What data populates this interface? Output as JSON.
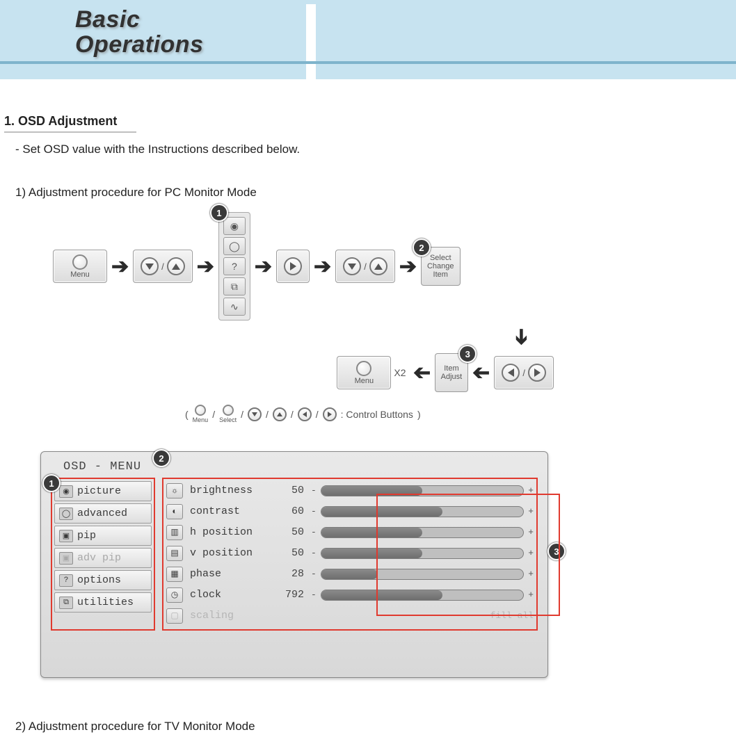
{
  "header": {
    "title_line1": "Basic",
    "title_line2": "Operations"
  },
  "section": {
    "heading": "1. OSD Adjustment",
    "intro": "- Set OSD value with the Instructions described below.",
    "sub1": "1) Adjustment procedure for PC Monitor Mode",
    "sub2": "2) Adjustment procedure for TV Monitor Mode"
  },
  "flow": {
    "menu_label": "Menu",
    "step2": {
      "l1": "Select",
      "l2": "Change",
      "l3": "Item"
    },
    "step3": {
      "l1": "Item",
      "l2": "Adjust"
    },
    "menu_x2_label": "Menu",
    "menu_x2_suffix": "X2",
    "badges": {
      "b1": "1",
      "b2": "2",
      "b3": "3"
    },
    "legend_suffix": ": Control Buttons",
    "legend_menu": "Menu",
    "legend_select": "Select",
    "category_icons": [
      "◉",
      "◯",
      "?",
      "⧉",
      "∿"
    ]
  },
  "osd": {
    "title": "OSD - MENU",
    "badges": {
      "b1": "1",
      "b2": "2",
      "b3": "3"
    },
    "categories": [
      {
        "icon": "◉",
        "label": "picture",
        "disabled": false
      },
      {
        "icon": "◯",
        "label": "advanced",
        "disabled": false
      },
      {
        "icon": "▣",
        "label": "pip",
        "disabled": false
      },
      {
        "icon": "▣",
        "label": "adv pip",
        "disabled": true
      },
      {
        "icon": "?",
        "label": "options",
        "disabled": false
      },
      {
        "icon": "⧉",
        "label": "utilities",
        "disabled": false
      }
    ],
    "items": [
      {
        "icon": "☼",
        "name": "brightness",
        "value": "50",
        "fill": 50
      },
      {
        "icon": "◐",
        "name": "contrast",
        "value": "60",
        "fill": 60
      },
      {
        "icon": "▥",
        "name": "h position",
        "value": "50",
        "fill": 50
      },
      {
        "icon": "▤",
        "name": "v position",
        "value": "50",
        "fill": 50
      },
      {
        "icon": "▦",
        "name": "phase",
        "value": "28",
        "fill": 28
      },
      {
        "icon": "◷",
        "name": "clock",
        "value": "792",
        "fill": 60
      },
      {
        "icon": "▢",
        "name": "scaling",
        "value": "",
        "fill": null,
        "trailing": "fill all",
        "disabled": true
      }
    ]
  }
}
